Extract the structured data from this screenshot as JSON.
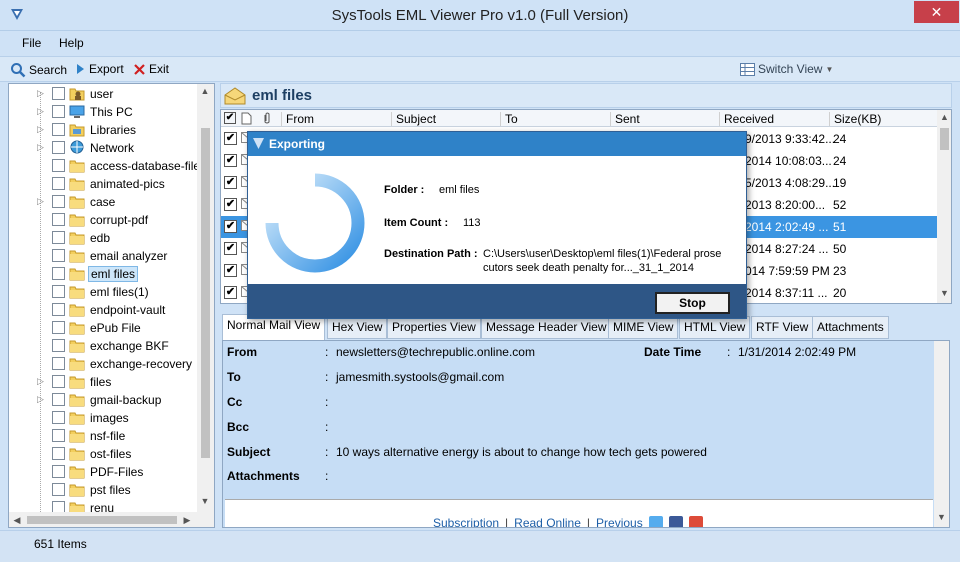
{
  "window": {
    "title": "SysTools EML Viewer Pro v1.0 (Full Version)",
    "close_glyph": "✕"
  },
  "menu": {
    "file": "File",
    "help": "Help"
  },
  "toolbar": {
    "search": "Search",
    "export": "Export",
    "exit": "Exit",
    "switch_view": "Switch View"
  },
  "tree": {
    "items": [
      {
        "label": "user",
        "icon": "user-folder-icon",
        "expandable": true
      },
      {
        "label": "This PC",
        "icon": "computer-icon",
        "expandable": true
      },
      {
        "label": "Libraries",
        "icon": "libraries-icon",
        "expandable": true
      },
      {
        "label": "Network",
        "icon": "network-icon",
        "expandable": true
      },
      {
        "label": "access-database-file",
        "icon": "folder-icon",
        "expandable": false
      },
      {
        "label": "animated-pics",
        "icon": "folder-icon",
        "expandable": false
      },
      {
        "label": "case",
        "icon": "folder-icon",
        "expandable": true
      },
      {
        "label": "corrupt-pdf",
        "icon": "folder-icon",
        "expandable": false
      },
      {
        "label": "edb",
        "icon": "folder-icon",
        "expandable": false
      },
      {
        "label": "email analyzer",
        "icon": "folder-icon",
        "expandable": false
      },
      {
        "label": "eml files",
        "icon": "folder-icon",
        "expandable": false,
        "selected": true
      },
      {
        "label": "eml files(1)",
        "icon": "folder-icon",
        "expandable": false
      },
      {
        "label": "endpoint-vault",
        "icon": "folder-icon",
        "expandable": false
      },
      {
        "label": "ePub File",
        "icon": "folder-icon",
        "expandable": false
      },
      {
        "label": "exchange BKF",
        "icon": "folder-icon",
        "expandable": false
      },
      {
        "label": "exchange-recovery",
        "icon": "folder-icon",
        "expandable": false
      },
      {
        "label": "files",
        "icon": "folder-icon",
        "expandable": true
      },
      {
        "label": "gmail-backup",
        "icon": "folder-icon",
        "expandable": true
      },
      {
        "label": "images",
        "icon": "folder-icon",
        "expandable": false
      },
      {
        "label": "nsf-file",
        "icon": "folder-icon",
        "expandable": false
      },
      {
        "label": "ost-files",
        "icon": "folder-icon",
        "expandable": false
      },
      {
        "label": "PDF-Files",
        "icon": "folder-icon",
        "expandable": false
      },
      {
        "label": "pst files",
        "icon": "folder-icon",
        "expandable": false
      },
      {
        "label": "renu",
        "icon": "folder-icon",
        "expandable": false
      }
    ]
  },
  "main": {
    "header_title": "eml files",
    "columns": {
      "from": "From",
      "subject": "Subject",
      "to": "To",
      "sent": "Sent",
      "received": "Received",
      "size": "Size(KB)"
    },
    "rows": [
      {
        "received": "9/2013 9:33:42...",
        "size": "24",
        "selected": false
      },
      {
        "received": "2014 10:08:03...",
        "size": "24",
        "selected": false
      },
      {
        "received": "5/2013 4:08:29...",
        "size": "19",
        "selected": false
      },
      {
        "received": "2013 8:20:00...",
        "size": "52",
        "selected": false
      },
      {
        "received": "2014 2:02:49 ...",
        "size": "51",
        "selected": true
      },
      {
        "received": "2014 8:27:24 ...",
        "size": "50",
        "selected": false
      },
      {
        "received": "014 7:59:59 PM",
        "size": "23",
        "selected": false
      },
      {
        "received": "2014 8:37:11 ...",
        "size": "20",
        "selected": false
      }
    ]
  },
  "tabs": [
    {
      "label": "Normal Mail View",
      "active": true
    },
    {
      "label": "Hex View"
    },
    {
      "label": "Properties View"
    },
    {
      "label": "Message Header View"
    },
    {
      "label": "MIME View"
    },
    {
      "label": "HTML View"
    },
    {
      "label": "RTF View"
    },
    {
      "label": "Attachments"
    }
  ],
  "detail": {
    "from_label": "From",
    "from_value": "newsletters@techrepublic.online.com",
    "date_label": "Date Time",
    "date_value": "1/31/2014 2:02:49 PM",
    "to_label": "To",
    "to_value": "jamesmith.systools@gmail.com",
    "cc_label": "Cc",
    "bcc_label": "Bcc",
    "subject_label": "Subject",
    "subject_value": "10 ways alternative energy is about to change how tech gets powered",
    "attachments_label": "Attachments",
    "colon": ":",
    "footer": {
      "subscription": "Subscription",
      "read_online": "Read Online",
      "previous": "Previous"
    }
  },
  "dialog": {
    "title": "Exporting",
    "folder_label": "Folder :",
    "folder_value": "eml files",
    "count_label": "Item Count :",
    "count_value": "113",
    "dest_label": "Destination Path :",
    "dest_value_1": "C:\\Users\\user\\Desktop\\eml files(1)\\Federal prose",
    "dest_value_2": "cutors seek death penalty for..._31_1_2014",
    "stop": "Stop"
  },
  "status": {
    "items": "651 Items"
  },
  "colors": {
    "accent": "#2f82c8",
    "selection": "#3b95e2",
    "window_bg": "#cfe2f6",
    "dialog_footer": "#2e5686"
  }
}
